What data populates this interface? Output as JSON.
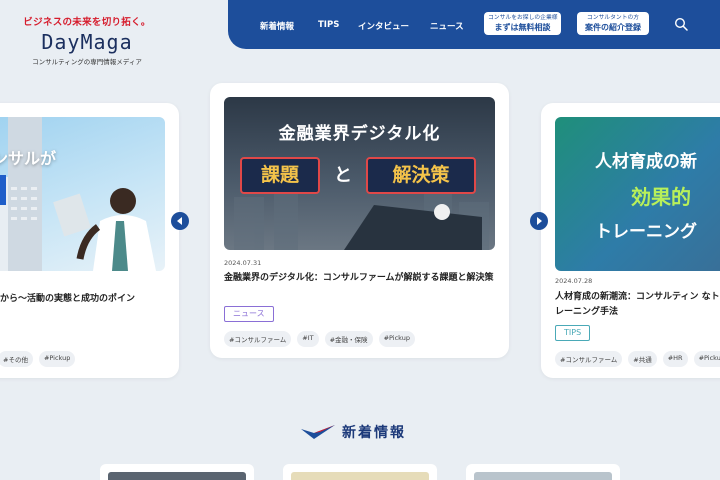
{
  "logo": {
    "tagline": "ビジネスの未来を切り拓く。",
    "name": "DayMaga",
    "subtitle": "コンサルティングの専門情報メディア"
  },
  "nav": {
    "items": [
      "新着情報",
      "TIPS",
      "インタビュー",
      "ニュース"
    ],
    "box1": {
      "small": "コンサルをお探しの企業様",
      "big": "まずは無料相談"
    },
    "box2": {
      "small": "コンサルタントの方",
      "big": "案件の紹介登録"
    }
  },
  "cards": [
    {
      "image_text": "ンサルが",
      "title": "から〜活動の実態と成功のポイン",
      "tags": [
        "#その他",
        "#Pickup"
      ]
    },
    {
      "image_text_line1": "金融業界デジタル化",
      "image_text_box1": "課題",
      "image_text_and": "と",
      "image_text_box2": "解決策",
      "date": "2024.07.31",
      "title": "金融業界のデジタル化：コンサルファームが解説する課題と解決策",
      "badge": "ニュース",
      "tags": [
        "#コンサルファーム",
        "#IT",
        "#金融・保険",
        "#Pickup"
      ]
    },
    {
      "image_text_line1": "人材育成の新",
      "image_text_line2": "効果的",
      "image_text_line3": "トレーニング",
      "date": "2024.07.28",
      "title": "人材育成の新潮流：コンサルティン なトレーニング手法",
      "badge": "TIPS",
      "tags": [
        "#コンサルファーム",
        "#共通",
        "#HR",
        "#Pickup"
      ]
    }
  ],
  "section": {
    "title": "新着情報"
  },
  "colors": {
    "brand_blue": "#1d4e9b",
    "accent_red": "#d61c2c",
    "badge_news": "#8a6fd6",
    "badge_tips": "#4aa9b7"
  }
}
